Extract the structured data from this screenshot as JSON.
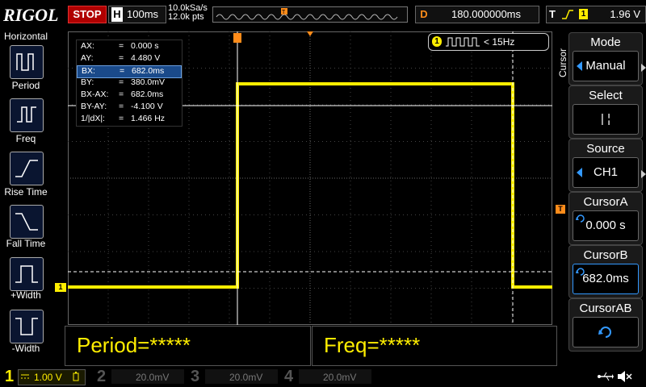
{
  "brand": "RIGOL",
  "run_state": "STOP",
  "horizontal": {
    "key": "H",
    "timebase": "100ms",
    "sample_rate": "10.0kSa/s",
    "points": "12.0k pts"
  },
  "delay": {
    "key": "D",
    "value": "180.000000ms"
  },
  "trigger": {
    "key": "T",
    "channel": "1",
    "level": "1.96 V"
  },
  "left_panel": {
    "title": "Horizontal",
    "items": [
      {
        "label": "Period"
      },
      {
        "label": "Freq"
      },
      {
        "label": "Rise Time"
      },
      {
        "label": "Fall Time"
      },
      {
        "label": "+Width"
      },
      {
        "label": "-Width"
      }
    ]
  },
  "cursor_info": [
    {
      "name": "AX:",
      "eq": "=",
      "value": "0.000 s"
    },
    {
      "name": "AY:",
      "eq": "=",
      "value": "4.480 V"
    },
    {
      "name": "BX:",
      "eq": "=",
      "value": "682.0ms"
    },
    {
      "name": "BY:",
      "eq": "=",
      "value": "380.0mV"
    },
    {
      "name": "BX-AX:",
      "eq": "=",
      "value": "682.0ms"
    },
    {
      "name": "BY-AY:",
      "eq": "=",
      "value": "-4.100 V"
    },
    {
      "name": "1/|dX|:",
      "eq": "=",
      "value": "1.466 Hz"
    }
  ],
  "freq_badge": {
    "channel": "1",
    "text": "< 15Hz"
  },
  "right_menu": {
    "side_label": "Cursor",
    "items": [
      {
        "title": "Mode",
        "value": "Manual"
      },
      {
        "title": "Select",
        "value": "| ¦"
      },
      {
        "title": "Source",
        "value": "CH1"
      },
      {
        "title": "CursorA",
        "value": "0.000 s"
      },
      {
        "title": "CursorB",
        "value": "682.0ms"
      },
      {
        "title": "CursorAB",
        "value": ""
      }
    ]
  },
  "measurements": {
    "period": "Period=*****",
    "freq": "Freq=*****"
  },
  "channels": [
    {
      "num": "1",
      "scale": "1.00 V",
      "color": "#ffee00"
    },
    {
      "num": "2",
      "scale": "20.0mV",
      "color": "#00c8ff"
    },
    {
      "num": "3",
      "scale": "20.0mV",
      "color": "#ff00ff"
    },
    {
      "num": "4",
      "scale": "20.0mV",
      "color": "#3a7fff"
    }
  ],
  "colors": {
    "ch1": "#ffee00",
    "accent_orange": "#ff8c1a",
    "stop_red": "#b00000",
    "selected_blue": "#1a4a8a"
  }
}
